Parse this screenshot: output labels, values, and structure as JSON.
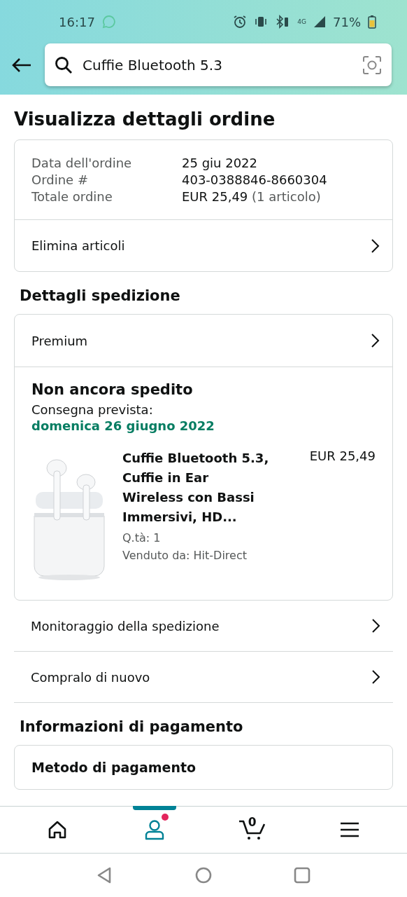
{
  "status_bar": {
    "time": "16:17",
    "network": "4G",
    "battery": "71%"
  },
  "search": {
    "value": "Cuffie Bluetooth 5.3"
  },
  "title": "Visualizza dettagli ordine",
  "order_summary": {
    "rows": [
      {
        "label": "Data dell'ordine",
        "value": "25 giu 2022"
      },
      {
        "label": "Ordine #",
        "value": "403-0388846-8660304"
      },
      {
        "label": "Totale ordine",
        "value": "EUR 25,49",
        "note": "(1 articolo)"
      }
    ],
    "link": "Elimina articoli"
  },
  "shipping": {
    "heading": "Dettagli spedizione",
    "service": "Premium",
    "status": "Non ancora spedito",
    "delivery_label": "Consegna prevista:",
    "delivery_date": "domenica 26 giugno 2022",
    "item": {
      "kind": "picture",
      "name": "Cuffie Bluetooth 5.3, Cuffie in Ear Wireless con Bassi Immersivi, HD...",
      "price": "EUR 25,49",
      "quantity": "Q.tà: 1",
      "seller": "Venduto da: Hit-Direct"
    }
  },
  "actions": [
    "Monitoraggio della spedizione",
    "Compralo di nuovo"
  ],
  "payment": {
    "heading": "Informazioni di pagamento",
    "card_title": "Metodo di pagamento"
  },
  "bottom_nav": [
    {
      "kind": "home",
      "selected": false,
      "badge": false
    },
    {
      "kind": "account",
      "selected": true,
      "badge": true
    },
    {
      "kind": "cart",
      "selected": false,
      "badge": false,
      "count": "0"
    },
    {
      "kind": "menu",
      "selected": false,
      "badge": false
    }
  ]
}
